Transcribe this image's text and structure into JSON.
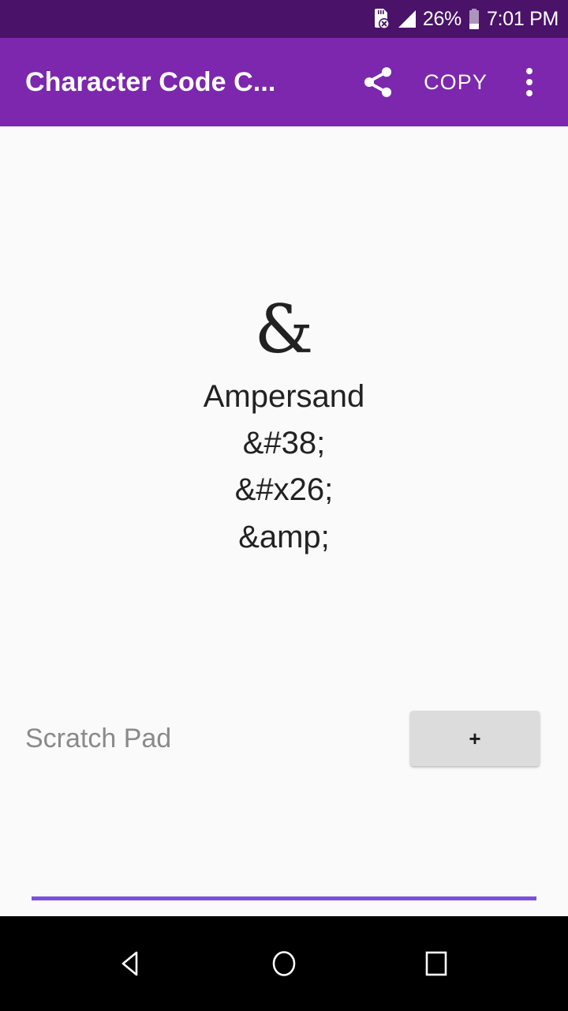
{
  "status_bar": {
    "sd_card_icon": "sd-card-error-icon",
    "signal_icon": "signal-strength-icon",
    "battery_percent": "26%",
    "battery_icon": "battery-icon",
    "time": "7:01 PM",
    "background_color": "#4a1268",
    "text_color": "#ffffff"
  },
  "app_bar": {
    "title": "Character Code C...",
    "share_icon": "share-icon",
    "copy_label": "COPY",
    "overflow_icon": "overflow-menu-icon",
    "background_color": "#7c27ad",
    "text_color": "#ffffff"
  },
  "main": {
    "glyph": "&",
    "character_name": "Ampersand",
    "entities": [
      "&#38;",
      "&#x26;",
      "&amp;"
    ],
    "text_color": "#222222",
    "background_color": "#fafafa"
  },
  "scratch_pad": {
    "placeholder": "Scratch Pad",
    "value": "",
    "add_label": "+",
    "underline_color": "#7b4fe0",
    "button_color": "#dcdcdc",
    "placeholder_color": "#8a8a8a"
  },
  "nav_bar": {
    "back_icon": "back-triangle-icon",
    "home_icon": "home-circle-icon",
    "recents_icon": "recents-square-icon",
    "background_color": "#000000"
  }
}
